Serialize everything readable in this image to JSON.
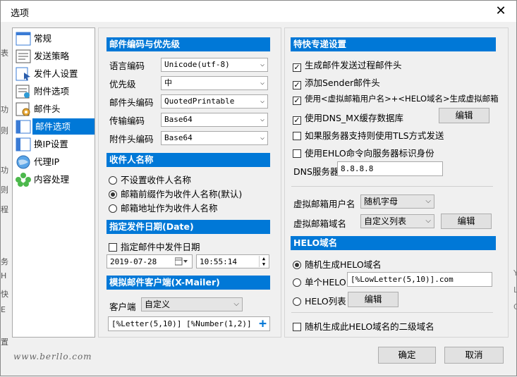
{
  "window": {
    "title": "选项",
    "close_glyph": "✕"
  },
  "bg_left_chars": [
    "表",
    "功",
    "则",
    "功",
    "则",
    "程",
    "务",
    "H",
    "快",
    "E",
    "置"
  ],
  "bg_right_chars": [
    "Y",
    "L",
    "G"
  ],
  "nav": {
    "items": [
      {
        "label": "常规",
        "icon": "general-icon",
        "selected": false
      },
      {
        "label": "发送策略",
        "icon": "policy-icon",
        "selected": false
      },
      {
        "label": "发件人设置",
        "icon": "sender-icon",
        "selected": false
      },
      {
        "label": "附件选项",
        "icon": "attachment-icon",
        "selected": false
      },
      {
        "label": "邮件头",
        "icon": "header-icon",
        "selected": false
      },
      {
        "label": "邮件选项",
        "icon": "mail-options-icon",
        "selected": true
      },
      {
        "label": "换IP设置",
        "icon": "ip-icon",
        "selected": false
      },
      {
        "label": "代理IP",
        "icon": "proxy-icon",
        "selected": false
      },
      {
        "label": "内容处理",
        "icon": "content-icon",
        "selected": false
      }
    ]
  },
  "encoding": {
    "heading": "邮件编码与优先级",
    "rows": [
      {
        "label": "语言编码",
        "value": "Unicode(utf-8)"
      },
      {
        "label": "优先级",
        "value": "中"
      },
      {
        "label": "邮件头编码",
        "value": "QuotedPrintable"
      },
      {
        "label": "传输编码",
        "value": "Base64"
      },
      {
        "label": "附件头编码",
        "value": "Base64"
      }
    ]
  },
  "recipient": {
    "heading": "收件人名称",
    "options": [
      {
        "label": "不设置收件人名称",
        "checked": false
      },
      {
        "label": "邮箱前缀作为收件人名称(默认)",
        "checked": true
      },
      {
        "label": "邮箱地址作为收件人名称",
        "checked": false
      }
    ]
  },
  "date": {
    "heading": "指定发件日期(Date)",
    "check_label": "指定邮件中发件日期",
    "checked": false,
    "date_value": "2019-07-28",
    "time_value": "10:55:14"
  },
  "xmailer": {
    "heading": "模拟邮件客户端(X-Mailer)",
    "client_label": "客户端",
    "client_value": "自定义",
    "custom_value": "[%Letter(5,10)] [%Number(1,2)]"
  },
  "special": {
    "heading": "特快专递设置",
    "checks": [
      {
        "label": "生成邮件发送过程邮件头",
        "checked": true
      },
      {
        "label": "添加Sender邮件头",
        "checked": true
      },
      {
        "label": "使用<虚拟邮箱用户名>+<HELO域名>生成虚拟邮箱",
        "checked": true
      },
      {
        "label": "使用DNS_MX缓存数据库",
        "checked": true
      },
      {
        "label": "如果服务器支持则使用TLS方式发送",
        "checked": false
      },
      {
        "label": "使用EHLO命令向服务器标识身份",
        "checked": false
      }
    ],
    "edit_label": "编辑",
    "dns_label": "DNS服务器",
    "dns_value": "8.8.8.8",
    "vuser_label": "虚拟邮箱用户名",
    "vuser_value": "随机字母",
    "vdomain_label": "虚拟邮箱域名",
    "vdomain_value": "自定义列表",
    "vdomain_edit_label": "编辑"
  },
  "helo": {
    "heading": "HELO域名",
    "opt_random": "随机生成HELO域名",
    "opt_single": "单个HELO",
    "single_value": "[%LowLetter(5,10)].com",
    "opt_list": "HELO列表",
    "list_edit_label": "编辑",
    "selected": "random",
    "subdomain_label": "随机生成此HELO域名的二级域名",
    "subdomain_checked": false
  },
  "footer": {
    "watermark": "www.berllo.com",
    "ok_label": "确定",
    "cancel_label": "取消"
  },
  "colors": {
    "accent": "#0078d7"
  }
}
